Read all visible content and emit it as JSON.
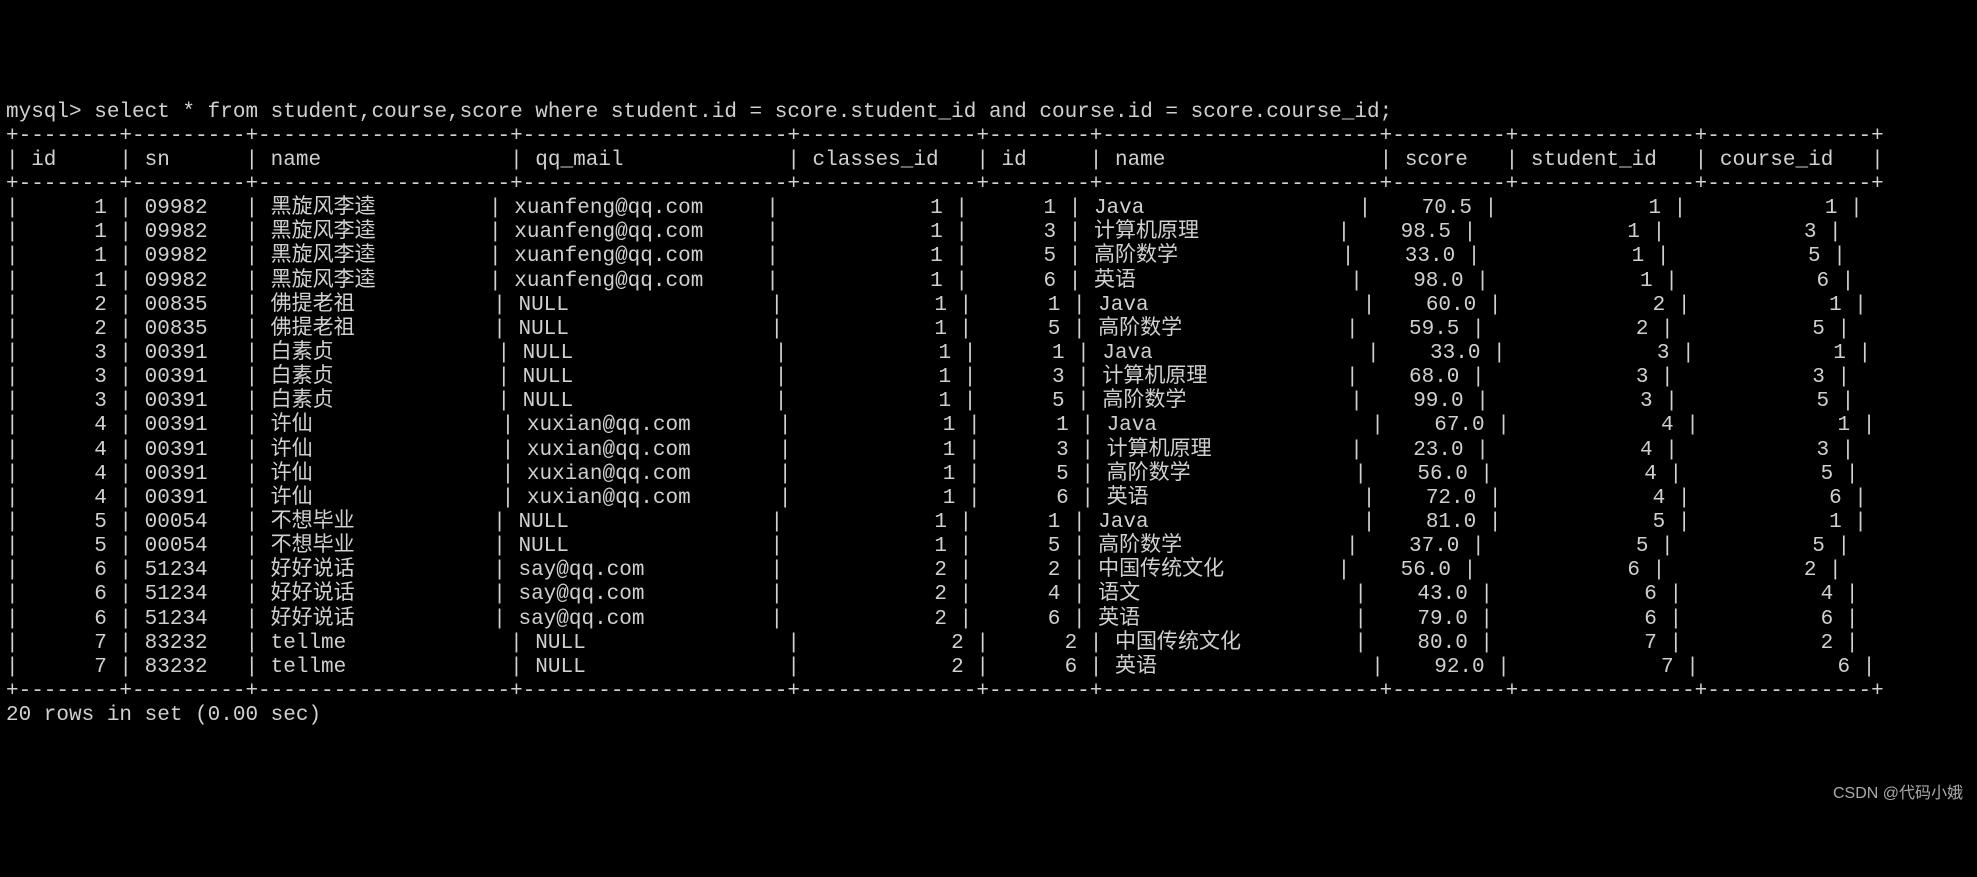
{
  "prompt": "mysql> ",
  "query": "select * from student,course,score where student.id = score.student_id and course.id = score.course_id;",
  "footer": "20 rows in set (0.00 sec)",
  "watermark": "CSDN @代码小娥",
  "columns": [
    {
      "name": "id",
      "width": 6,
      "align": "right"
    },
    {
      "name": "sn",
      "width": 7,
      "align": "left"
    },
    {
      "name": "name",
      "width": 18,
      "align": "left"
    },
    {
      "name": "qq_mail",
      "width": 19,
      "align": "left"
    },
    {
      "name": "classes_id",
      "width": 12,
      "align": "right"
    },
    {
      "name": "id",
      "width": 6,
      "align": "right"
    },
    {
      "name": "name",
      "width": 20,
      "align": "left"
    },
    {
      "name": "score",
      "width": 7,
      "align": "right"
    },
    {
      "name": "student_id",
      "width": 12,
      "align": "right"
    },
    {
      "name": "course_id",
      "width": 11,
      "align": "right"
    }
  ],
  "rows": [
    [
      "1",
      "09982",
      "黑旋风李逵",
      "xuanfeng@qq.com",
      "1",
      "1",
      "Java",
      "70.5",
      "1",
      "1"
    ],
    [
      "1",
      "09982",
      "黑旋风李逵",
      "xuanfeng@qq.com",
      "1",
      "3",
      "计算机原理",
      "98.5",
      "1",
      "3"
    ],
    [
      "1",
      "09982",
      "黑旋风李逵",
      "xuanfeng@qq.com",
      "1",
      "5",
      "高阶数学",
      "33.0",
      "1",
      "5"
    ],
    [
      "1",
      "09982",
      "黑旋风李逵",
      "xuanfeng@qq.com",
      "1",
      "6",
      "英语",
      "98.0",
      "1",
      "6"
    ],
    [
      "2",
      "00835",
      "佛提老祖",
      "NULL",
      "1",
      "1",
      "Java",
      "60.0",
      "2",
      "1"
    ],
    [
      "2",
      "00835",
      "佛提老祖",
      "NULL",
      "1",
      "5",
      "高阶数学",
      "59.5",
      "2",
      "5"
    ],
    [
      "3",
      "00391",
      "白素贞",
      "NULL",
      "1",
      "1",
      "Java",
      "33.0",
      "3",
      "1"
    ],
    [
      "3",
      "00391",
      "白素贞",
      "NULL",
      "1",
      "3",
      "计算机原理",
      "68.0",
      "3",
      "3"
    ],
    [
      "3",
      "00391",
      "白素贞",
      "NULL",
      "1",
      "5",
      "高阶数学",
      "99.0",
      "3",
      "5"
    ],
    [
      "4",
      "00391",
      "许仙",
      "xuxian@qq.com",
      "1",
      "1",
      "Java",
      "67.0",
      "4",
      "1"
    ],
    [
      "4",
      "00391",
      "许仙",
      "xuxian@qq.com",
      "1",
      "3",
      "计算机原理",
      "23.0",
      "4",
      "3"
    ],
    [
      "4",
      "00391",
      "许仙",
      "xuxian@qq.com",
      "1",
      "5",
      "高阶数学",
      "56.0",
      "4",
      "5"
    ],
    [
      "4",
      "00391",
      "许仙",
      "xuxian@qq.com",
      "1",
      "6",
      "英语",
      "72.0",
      "4",
      "6"
    ],
    [
      "5",
      "00054",
      "不想毕业",
      "NULL",
      "1",
      "1",
      "Java",
      "81.0",
      "5",
      "1"
    ],
    [
      "5",
      "00054",
      "不想毕业",
      "NULL",
      "1",
      "5",
      "高阶数学",
      "37.0",
      "5",
      "5"
    ],
    [
      "6",
      "51234",
      "好好说话",
      "say@qq.com",
      "2",
      "2",
      "中国传统文化",
      "56.0",
      "6",
      "2"
    ],
    [
      "6",
      "51234",
      "好好说话",
      "say@qq.com",
      "2",
      "4",
      "语文",
      "43.0",
      "6",
      "4"
    ],
    [
      "6",
      "51234",
      "好好说话",
      "say@qq.com",
      "2",
      "6",
      "英语",
      "79.0",
      "6",
      "6"
    ],
    [
      "7",
      "83232",
      "tellme",
      "NULL",
      "2",
      "2",
      "中国传统文化",
      "80.0",
      "7",
      "2"
    ],
    [
      "7",
      "83232",
      "tellme",
      "NULL",
      "2",
      "6",
      "英语",
      "92.0",
      "7",
      "6"
    ]
  ]
}
